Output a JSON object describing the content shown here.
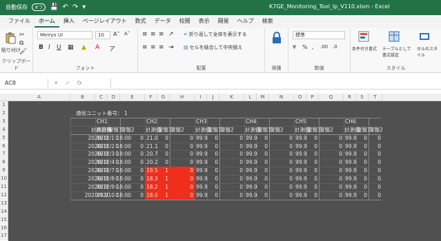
{
  "app": {
    "autosave_label": "自動保存",
    "autosave_state": "オフ",
    "filename": "K7GE_Monitoring_Tool_lp_V110.xlsm - Excel"
  },
  "tabs": [
    "ファイル",
    "ホーム",
    "挿入",
    "ページレイアウト",
    "数式",
    "データ",
    "校閲",
    "表示",
    "開発",
    "ヘルプ",
    "検索"
  ],
  "active_tab": "ホーム",
  "ribbon": {
    "clipboard_label": "クリップボード",
    "paste_label": "貼り付け",
    "font_label": "フォント",
    "font_name": "Meiryo UI",
    "font_size": "10",
    "alignment_label": "配置",
    "wrap_text": "折り返して全体を表示する",
    "merge_center": "セルを結合して中央揃え",
    "protect_label": "保護",
    "number_label": "数値",
    "number_format": "標準",
    "styles_label": "スタイル",
    "cond_format": "条件付き書式",
    "table_format": "テーブルとして書式設定",
    "cell_styles": "セルのスタイル"
  },
  "formula_bar": {
    "name_box": "AC8",
    "fx": "fx",
    "value": ""
  },
  "columns": [
    "A",
    "B",
    "C",
    "D",
    "E",
    "F",
    "G",
    "H",
    "I",
    "J",
    "K",
    "L",
    "M",
    "N",
    "O",
    "P",
    "Q",
    "R",
    "S",
    "T"
  ],
  "rows": [
    "1",
    "2",
    "3",
    "4",
    "5",
    "6",
    "7",
    "8",
    "9",
    "10",
    "11",
    "12",
    "13",
    "14",
    "15",
    "16",
    "17"
  ],
  "sheet": {
    "unit_label": "通信ユニット番号：",
    "unit_number": "1",
    "datetime_header": "計測日時",
    "channels": [
      "CH1",
      "CH2",
      "CH3",
      "CH4",
      "CH5",
      "CH6"
    ],
    "sub_headers": [
      "計測値",
      "警報1",
      "警報2"
    ],
    "rows": [
      {
        "dt": "2020/12/1 18:00",
        "vals": [
          "99.9",
          "0",
          "0",
          "21.0",
          "0",
          "0",
          "99.9",
          "0",
          "0",
          "99.9",
          "0",
          "0",
          "99.9",
          "0",
          "0",
          "99.9",
          "0",
          "0"
        ]
      },
      {
        "dt": "2020/12/2 18:00",
        "vals": [
          "99.9",
          "0",
          "0",
          "21.1",
          "0",
          "0",
          "99.9",
          "0",
          "0",
          "99.9",
          "0",
          "0",
          "99.9",
          "0",
          "0",
          "99.9",
          "0",
          "0"
        ]
      },
      {
        "dt": "2020/12/3 18:00",
        "vals": [
          "99.9",
          "0",
          "0",
          "20.7",
          "0",
          "0",
          "99.9",
          "0",
          "0",
          "99.9",
          "0",
          "0",
          "99.9",
          "0",
          "0",
          "99.9",
          "0",
          "0"
        ]
      },
      {
        "dt": "2020/12/4 18:00",
        "vals": [
          "99.9",
          "0",
          "0",
          "20.2",
          "0",
          "0",
          "99.9",
          "0",
          "0",
          "99.9",
          "0",
          "0",
          "99.9",
          "0",
          "0",
          "99.9",
          "0",
          "0"
        ]
      },
      {
        "dt": "2020/12/7 18:00",
        "vals": [
          "99.9",
          "0",
          "0",
          "19.5",
          "1",
          "0",
          "99.9",
          "0",
          "0",
          "99.9",
          "0",
          "0",
          "99.9",
          "0",
          "0",
          "99.9",
          "0",
          "0"
        ],
        "alert": true
      },
      {
        "dt": "2020/12/8 18:00",
        "vals": [
          "99.9",
          "0",
          "0",
          "18.3",
          "1",
          "0",
          "99.9",
          "0",
          "0",
          "99.9",
          "0",
          "0",
          "99.9",
          "0",
          "0",
          "99.9",
          "0",
          "0"
        ],
        "alert": true
      },
      {
        "dt": "2020/12/9 18:00",
        "vals": [
          "99.9",
          "0",
          "0",
          "18.2",
          "1",
          "0",
          "99.9",
          "0",
          "0",
          "99.9",
          "0",
          "0",
          "99.9",
          "0",
          "0",
          "99.9",
          "0",
          "0"
        ],
        "alert": true
      },
      {
        "dt": "2020/12/10 18:00",
        "vals": [
          "99.9",
          "0",
          "0",
          "18.0",
          "1",
          "0",
          "99.9",
          "0",
          "0",
          "99.9",
          "0",
          "0",
          "99.9",
          "0",
          "0",
          "99.9",
          "0",
          "0"
        ],
        "alert": true
      }
    ]
  },
  "colors": {
    "excel_green": "#217346",
    "sheet_bg": "#505050",
    "alert_red": "#ef2e1b"
  }
}
